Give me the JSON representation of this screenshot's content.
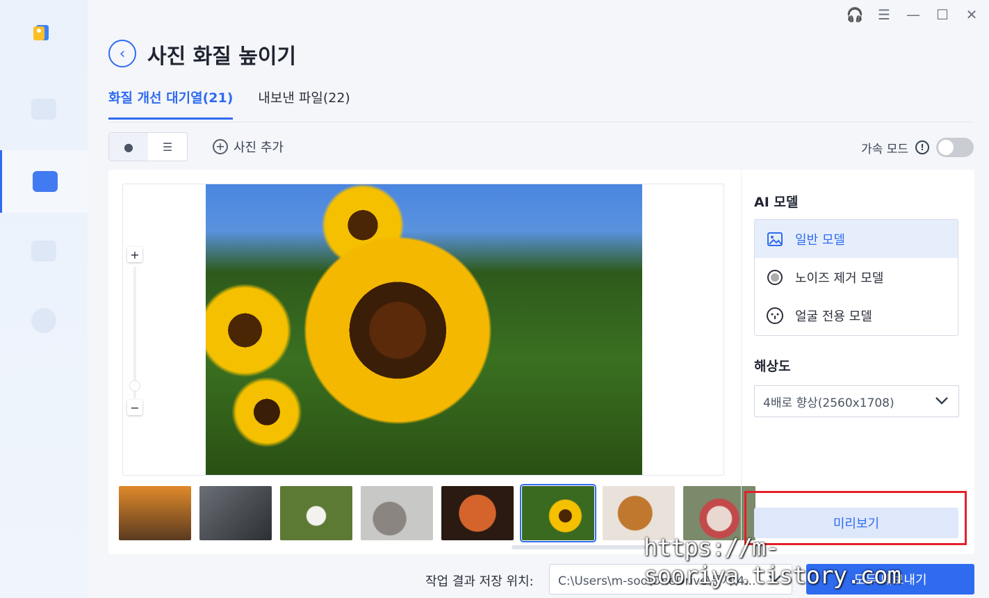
{
  "header": {
    "title": "사진 화질 높이기",
    "back_icon": "back-arrow-icon"
  },
  "tabs": [
    {
      "label": "화질 개선 대기열(21)",
      "active": true
    },
    {
      "label": "내보낸 파일(22)",
      "active": false
    }
  ],
  "toolbar": {
    "add_photo_label": "사진 추가",
    "accel_mode_label": "가속 모드",
    "accel_mode_on": false
  },
  "settings": {
    "ai_model_title": "AI 모델",
    "models": [
      {
        "label": "일반 모델",
        "icon": "image-icon",
        "selected": true
      },
      {
        "label": "노이즈 제거 모델",
        "icon": "noise-icon",
        "selected": false
      },
      {
        "label": "얼굴 전용 모델",
        "icon": "face-icon",
        "selected": false
      }
    ],
    "resolution_title": "해상도",
    "resolution_value": "4배로 향상(2560x1708)",
    "preview_label": "미리보기"
  },
  "thumbnails": [
    {
      "name": "sunset",
      "color": "#c77a28"
    },
    {
      "name": "usb-drives",
      "color": "#555a60"
    },
    {
      "name": "puppy-white",
      "color": "#5d7a35"
    },
    {
      "name": "kitten",
      "color": "#9a9a98"
    },
    {
      "name": "food-pan",
      "color": "#8a4a22"
    },
    {
      "name": "sunflower",
      "color": "#d9a80e",
      "selected": true
    },
    {
      "name": "dog",
      "color": "#a86a30"
    },
    {
      "name": "dessert",
      "color": "#b56a64"
    }
  ],
  "bottom": {
    "save_location_label": "작업 결과 저장 위치:",
    "save_path": "C:\\Users\\m-soo\\OneDrive\\문서\\4...",
    "export_all_label": "모두 내보내기"
  },
  "watermark": "https://m-sooriya.tistory.com",
  "colors": {
    "accent": "#2f6bef",
    "highlight_box": "#e32128"
  }
}
